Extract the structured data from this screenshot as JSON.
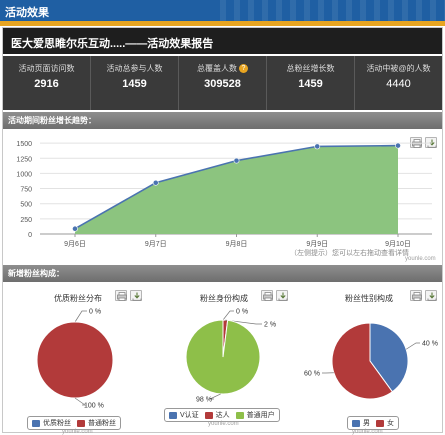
{
  "header": {
    "title": "活动效果"
  },
  "report": {
    "title": "医大爱思睢尔乐互动.....——活动效果报告"
  },
  "stats": [
    {
      "label": "活动页面访问数",
      "value": "2916"
    },
    {
      "label": "活动总参与人数",
      "value": "1459"
    },
    {
      "label": "总覆盖人数",
      "value": "309528",
      "badge": "?"
    },
    {
      "label": "总粉丝增长数",
      "value": "1459"
    },
    {
      "label": "活动中被@的人数",
      "value": "4440"
    }
  ],
  "trend_section": {
    "title": "活动期间粉丝增长趋势："
  },
  "trend_hint": "（左侧提示）您可以左右拖动查看详情",
  "watermarks": {
    "trend": "younle.com",
    "pie1": "younle.com",
    "pie2": "younle.com",
    "pie3": "younle.com"
  },
  "composition_section": {
    "title": "新增粉丝构成："
  },
  "colors": {
    "line": "#4a73b0",
    "area": "#8cc47f",
    "pie_red": "#b23a3a",
    "pie_blue": "#4a73b0",
    "pie_green": "#8ebf49",
    "header_blue": "#1f5fa3",
    "accent": "#e8a521"
  },
  "icons": [
    "print-icon",
    "download-icon",
    "help-icon"
  ],
  "chart_data": [
    {
      "type": "area",
      "title": "活动期间粉丝增长趋势：",
      "x": [
        "9月6日",
        "9月7日",
        "9月8日",
        "9月9日",
        "9月10日"
      ],
      "series": [
        {
          "values": [
            87,
            846,
            1211,
            1446,
            1459
          ]
        }
      ],
      "ylim": [
        0,
        1700
      ],
      "yticks": [
        0,
        250,
        500,
        750,
        1000,
        1250,
        1500
      ],
      "ytick_labels": [
        "0",
        "250",
        "500",
        "750",
        "1000",
        "1250",
        "1500"
      ],
      "grid": true
    },
    {
      "type": "pie",
      "title": "优质粉丝分布",
      "labels": [
        "优质粉丝",
        "普通粉丝"
      ],
      "values": [
        0,
        100
      ],
      "value_labels": [
        "0 %",
        "100 %"
      ],
      "colors": [
        "#4a73b0",
        "#b23a3a"
      ]
    },
    {
      "type": "pie",
      "title": "粉丝身份构成",
      "labels": [
        "V认证",
        "达人",
        "普通用户"
      ],
      "values": [
        0,
        2,
        98
      ],
      "value_labels": [
        "0 %",
        "2 %",
        "98 %"
      ],
      "colors": [
        "#4a73b0",
        "#b23a3a",
        "#8ebf49"
      ]
    },
    {
      "type": "pie",
      "title": "粉丝性别构成",
      "labels": [
        "男",
        "女"
      ],
      "values": [
        40,
        60
      ],
      "value_labels": [
        "40 %",
        "60 %"
      ],
      "colors": [
        "#4a73b0",
        "#b23a3a"
      ]
    }
  ]
}
